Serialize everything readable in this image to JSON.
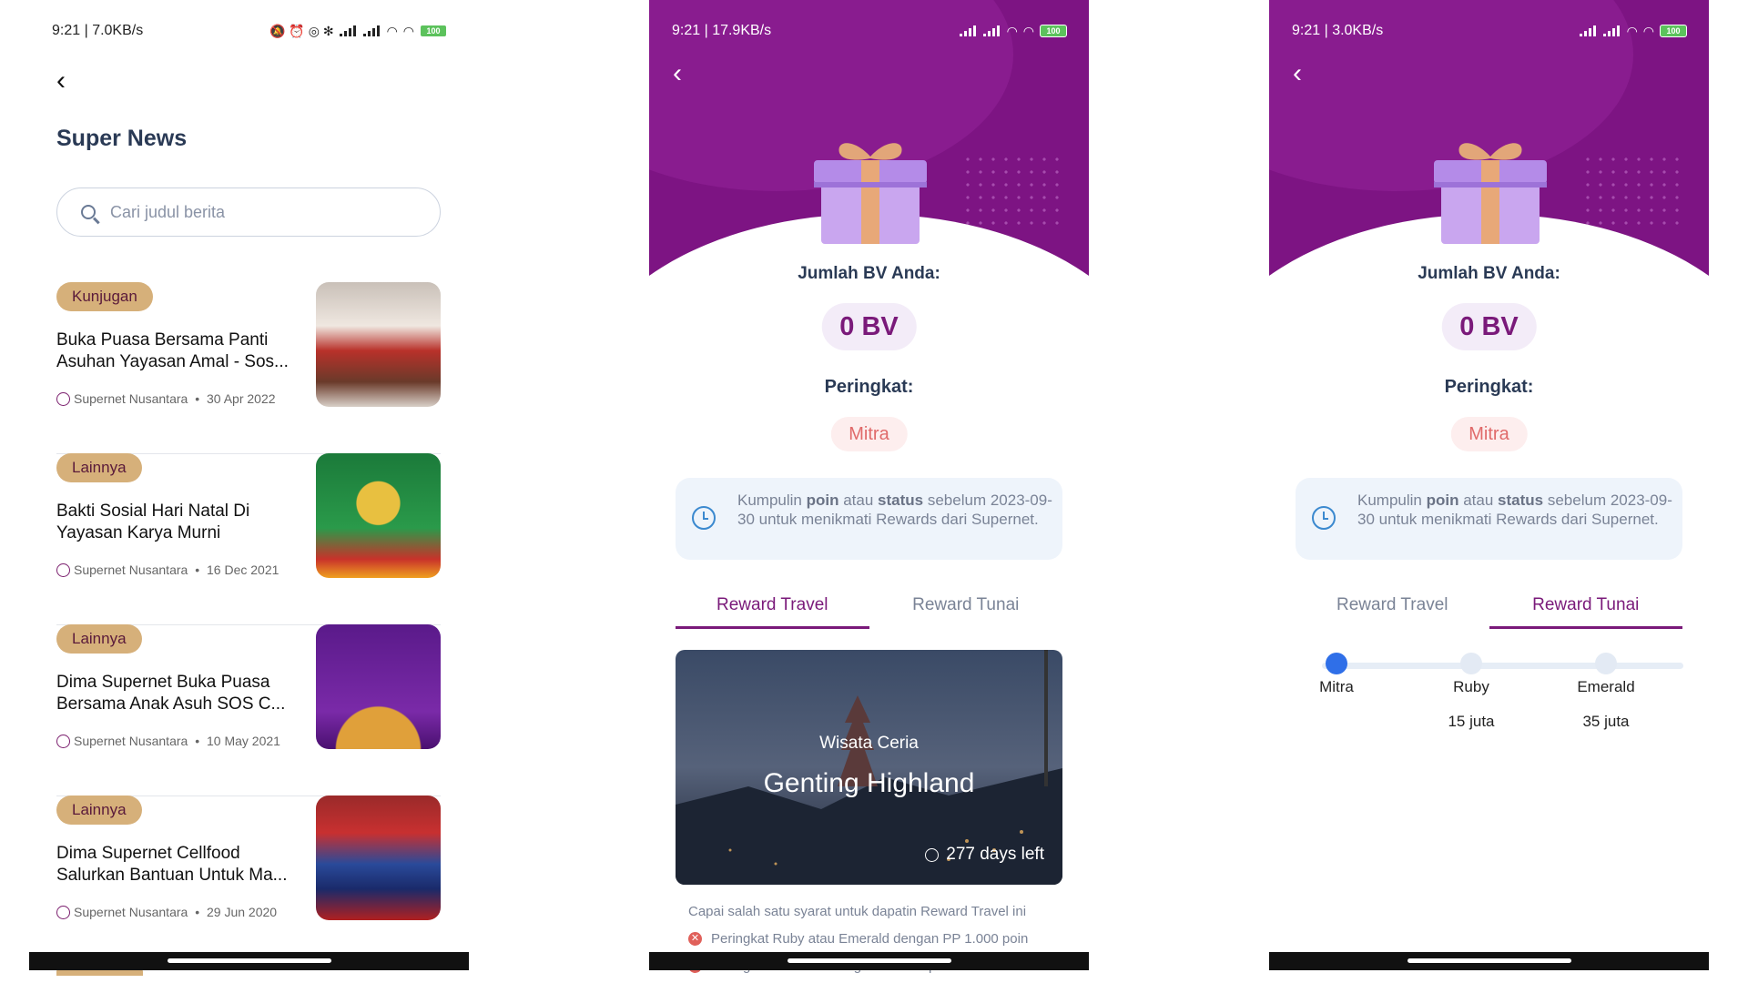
{
  "news_screen": {
    "status": {
      "left": "9:21 | 7.0KB/s",
      "icons": "🔕 ⏰ ◎ ✻",
      "battery": "100"
    },
    "title": "Super News",
    "search_placeholder": "Cari judul berita",
    "items": [
      {
        "category": "Kunjugan",
        "title": "Buka Puasa Bersama Panti Asuhan Yayasan Amal - Sos...",
        "author": "Supernet Nusantara",
        "date": "30 Apr 2022"
      },
      {
        "category": "Lainnya",
        "title": "Bakti Sosial Hari Natal Di Yayasan Karya Murni",
        "author": "Supernet Nusantara",
        "date": "16 Dec 2021"
      },
      {
        "category": "Lainnya",
        "title": "Dima Supernet Buka Puasa Bersama Anak Asuh SOS C...",
        "author": "Supernet Nusantara",
        "date": "10 May 2021"
      },
      {
        "category": "Lainnya",
        "title": "Dima Supernet Cellfood Salurkan Bantuan Untuk Ma...",
        "author": "Supernet Nusantara",
        "date": "29 Jun 2020"
      }
    ]
  },
  "reward_travel_screen": {
    "status": {
      "left": "9:21 | 17.9KB/s",
      "icons": "🔕 ⏰ ◎ ◘",
      "battery": "100"
    },
    "bv_label": "Jumlah BV Anda:",
    "bv_value": "0 BV",
    "rank_label": "Peringkat:",
    "rank_value": "Mitra",
    "info": {
      "pre": "Kumpulin ",
      "b1": "poin",
      "mid": " atau ",
      "b2": "status",
      "post": " sebelum 2023-09-30 untuk menikmati Rewards dari Supernet."
    },
    "tabs": [
      "Reward Travel",
      "Reward Tunai"
    ],
    "active_tab": "Reward Travel",
    "card": {
      "subtitle": "Wisata Ceria",
      "title": "Genting Highland",
      "days_left": "277 days left"
    },
    "requirements_title": "Capai salah satu syarat untuk dapatin Reward Travel ini",
    "requirements": [
      "Peringkat Ruby atau Emerald dengan PP 1.000 poin",
      "Peringkat Diamond dengan PP 700 poin"
    ]
  },
  "reward_cash_screen": {
    "status": {
      "left": "9:21 | 3.0KB/s",
      "icons": "🔕 ⏰ ◎ ◘",
      "battery": "100"
    },
    "bv_label": "Jumlah BV Anda:",
    "bv_value": "0 BV",
    "rank_label": "Peringkat:",
    "rank_value": "Mitra",
    "info": {
      "pre": "Kumpulin ",
      "b1": "poin",
      "mid": " atau ",
      "b2": "status",
      "post": " sebelum 2023-09-30 untuk menikmati Rewards dari Supernet."
    },
    "tabs": [
      "Reward Travel",
      "Reward Tunai"
    ],
    "active_tab": "Reward Tunai",
    "tiers": [
      {
        "name": "Mitra",
        "value": "",
        "reached": true
      },
      {
        "name": "Ruby",
        "value": "15 juta",
        "reached": false
      },
      {
        "name": "Emerald",
        "value": "35 juta",
        "reached": false
      }
    ]
  },
  "colors": {
    "brand_purple": "#7d1483",
    "badge_gold": "#d6b07a",
    "rank_red": "#e06a6a",
    "tier_blue": "#2f6fe8"
  }
}
